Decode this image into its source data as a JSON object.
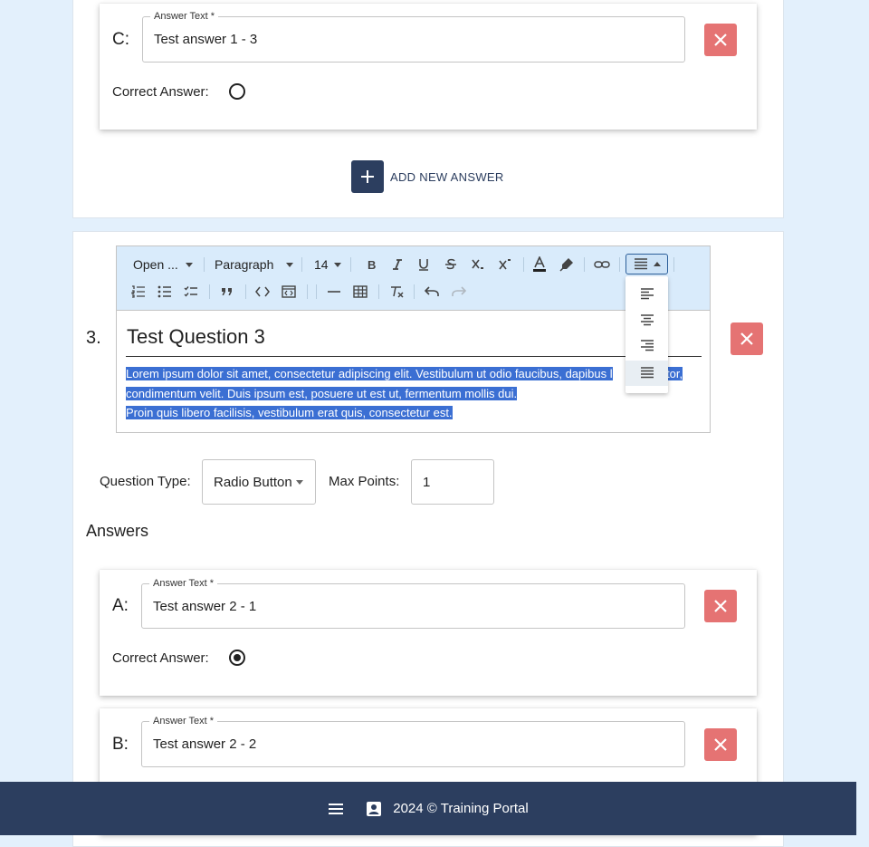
{
  "answer_c": {
    "letter": "C:",
    "field_label": "Answer Text *",
    "value": "Test answer 1 - 3",
    "correct_label": "Correct Answer:"
  },
  "add_answer": {
    "label": "ADD NEW ANSWER"
  },
  "question": {
    "number": "3.",
    "toolbar": {
      "font": "Open ...",
      "block": "Paragraph",
      "size": "14"
    },
    "heading": "Test Question 3",
    "body_line1": "Lorem ipsum dolor sit amet, consectetur adipiscing elit. Vestibulum ut odio faucibus, dapibus l",
    "body_line1_tail": "rttitor,",
    "body_line2": "condimentum velit. Duis ipsum est, posuere ut est ut, fermentum mollis dui.",
    "body_line3": "Proin quis libero facilisis, vestibulum erat quis, consectetur est.",
    "type_label": "Question Type:",
    "type_value": "Radio Button",
    "points_label": "Max Points:",
    "points_value": "1",
    "answers_heading": "Answers"
  },
  "answers": [
    {
      "letter": "A:",
      "field_label": "Answer Text *",
      "value": "Test answer 2 - 1",
      "correct_label": "Correct Answer:",
      "correct": true
    },
    {
      "letter": "B:",
      "field_label": "Answer Text *",
      "value": "Test answer 2 - 2"
    }
  ],
  "footer": {
    "text": "2024 © Training Portal"
  },
  "colors": {
    "accent": "#2c3e5f",
    "delete": "#e57373",
    "selection": "#3b6fd3",
    "toolbar_bg": "#d9ebfb",
    "page_bg": "#e3f0fc"
  },
  "icons": [
    "close-icon",
    "plus-icon",
    "bold-icon",
    "italic-icon",
    "underline-icon",
    "strikethrough-icon",
    "subscript-icon",
    "superscript-icon",
    "font-color-icon",
    "highlight-icon",
    "link-icon",
    "align-justify-icon",
    "numbered-list-icon",
    "bulleted-list-icon",
    "todo-list-icon",
    "blockquote-icon",
    "code-icon",
    "code-block-icon",
    "horizontal-line-icon",
    "table-icon",
    "remove-format-icon",
    "undo-icon",
    "redo-icon",
    "align-left-icon",
    "align-center-icon",
    "align-right-icon",
    "menu-icon",
    "contact-icon"
  ]
}
